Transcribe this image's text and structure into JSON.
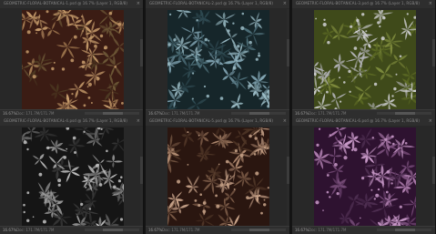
{
  "documents": [
    {
      "title": "GEOMETRIC-FLORAL-BOTANICAL-1.psd @ 16.7% (Layer 1, RGB/8)",
      "close": "×",
      "zoom": "16.67%",
      "info": "Doc: 171.7M/171.7M",
      "background": "#3b1c14",
      "leaf_colors": [
        "#a87f54",
        "#6f5a38",
        "#4d3a22",
        "#c49a6a"
      ]
    },
    {
      "title": "GEOMETRIC-FLORAL-BOTANICAL-2.psd @ 16.7% (Layer 1, RGB/8)",
      "close": "×",
      "zoom": "16.67%",
      "info": "Doc: 171.7M/171.7M",
      "background": "#16262a",
      "leaf_colors": [
        "#7fa2b0",
        "#4d6e78",
        "#2f4a52",
        "#9bbcc6"
      ]
    },
    {
      "title": "GEOMETRIC-FLORAL-BOTANICAL-3.psd @ 16.7% (Layer 1, RGB/8)",
      "close": "×",
      "zoom": "16.67%",
      "info": "Doc: 171.7M/171.7M",
      "background": "#3f4a1a",
      "leaf_colors": [
        "#b3b3b8",
        "#7d8a3c",
        "#5c6a24",
        "#d0d0d4"
      ]
    },
    {
      "title": "GEOMETRIC-FLORAL-BOTANICAL-4.psd @ 16.7% (Layer 1, RGB/8)",
      "close": "×",
      "zoom": "16.67%",
      "info": "Doc: 171.7M/171.7M",
      "background": "#151515",
      "leaf_colors": [
        "#9a9a9a",
        "#5e5e5e",
        "#3a3a3a",
        "#c2c2c2"
      ]
    },
    {
      "title": "GEOMETRIC-FLORAL-BOTANICAL-5.psd @ 16.7% (Layer 1, RGB/8)",
      "close": "×",
      "zoom": "16.67%",
      "info": "Doc: 171.7M/171.7M",
      "background": "#2a1610",
      "leaf_colors": [
        "#b08a70",
        "#7a5a46",
        "#4e3526",
        "#c9a48a"
      ]
    },
    {
      "title": "GEOMETRIC-FLORAL-BOTANICAL-6.psd @ 16.7% (Layer 1, RGB/8)",
      "close": "×",
      "zoom": "16.67%",
      "info": "Doc: 171.7M/171.7M",
      "background": "#2e1230",
      "leaf_colors": [
        "#b07fb0",
        "#7a4f7c",
        "#4f2f52",
        "#c99ac9"
      ]
    }
  ]
}
